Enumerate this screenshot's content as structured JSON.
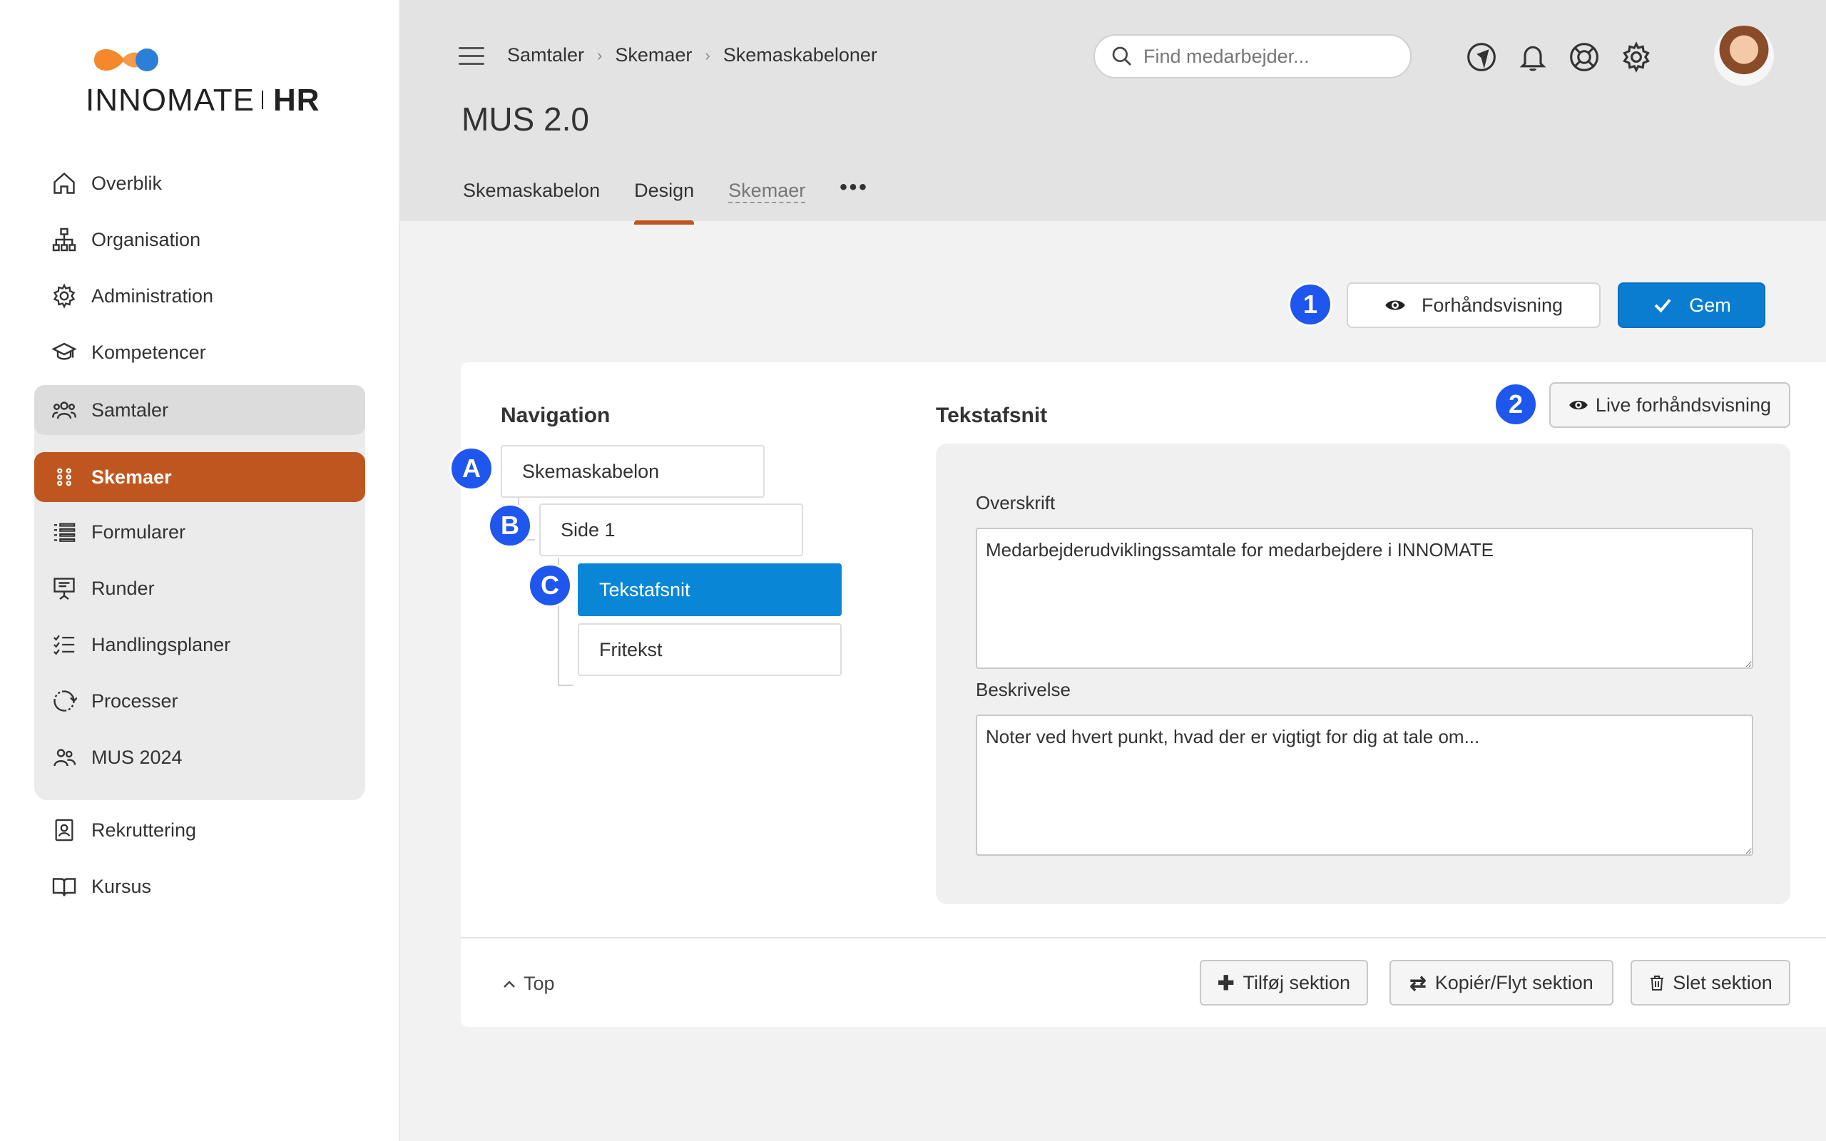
{
  "brand": {
    "name_left": "INNOMATE",
    "name_right": "HR",
    "accent_color": "#c0561f",
    "logo_colors": [
      "#f5882a",
      "#2b7fd8"
    ]
  },
  "sidebar": {
    "items": [
      {
        "label": "Overblik",
        "icon": "home-icon"
      },
      {
        "label": "Organisation",
        "icon": "org-chart-icon"
      },
      {
        "label": "Administration",
        "icon": "gear-icon"
      },
      {
        "label": "Kompetencer",
        "icon": "graduation-cap-icon"
      },
      {
        "label": "Samtaler",
        "icon": "people-icon"
      },
      {
        "label": "Skemaer",
        "icon": "grid-dots-icon"
      },
      {
        "label": "Formularer",
        "icon": "list-icon"
      },
      {
        "label": "Runder",
        "icon": "presentation-icon"
      },
      {
        "label": "Handlingsplaner",
        "icon": "checklist-icon"
      },
      {
        "label": "Processer",
        "icon": "cycle-icon"
      },
      {
        "label": "MUS 2024",
        "icon": "people-icon"
      },
      {
        "label": "Rekruttering",
        "icon": "id-badge-icon"
      },
      {
        "label": "Kursus",
        "icon": "book-icon"
      }
    ]
  },
  "header": {
    "breadcrumb": [
      "Samtaler",
      "Skemaer",
      "Skemaskabeloner"
    ],
    "title": "MUS 2.0",
    "tabs": [
      "Skemaskabelon",
      "Design",
      "Skemaer"
    ],
    "more": "•••",
    "search_placeholder": "Find medarbejder..."
  },
  "actions": {
    "preview_label": "Forhåndsvisning",
    "save_label": "Gem",
    "marker_1": "1",
    "marker_2": "2",
    "live_preview_label": "Live forhåndsvisning"
  },
  "navigation": {
    "heading": "Navigation",
    "nodes": [
      {
        "label": "Skemaskabelon",
        "marker": "A"
      },
      {
        "label": "Side 1",
        "marker": "B"
      },
      {
        "label": "Tekstafsnit",
        "marker": "C"
      },
      {
        "label": "Fritekst",
        "marker": ""
      }
    ]
  },
  "editor": {
    "heading": "Tekstafsnit",
    "heading_field_label": "Overskrift",
    "heading_field_value": "Medarbejderudviklingssamtale for medarbejdere i INNOMATE",
    "description_label": "Beskrivelse",
    "description_value": "Noter ved hvert punkt, hvad der er vigtigt for dig at tale om..."
  },
  "footer": {
    "top_label": "Top",
    "add_section": "Tilføj sektion",
    "copy_move_section": "Kopiér/Flyt sektion",
    "delete_section": "Slet sektion"
  }
}
